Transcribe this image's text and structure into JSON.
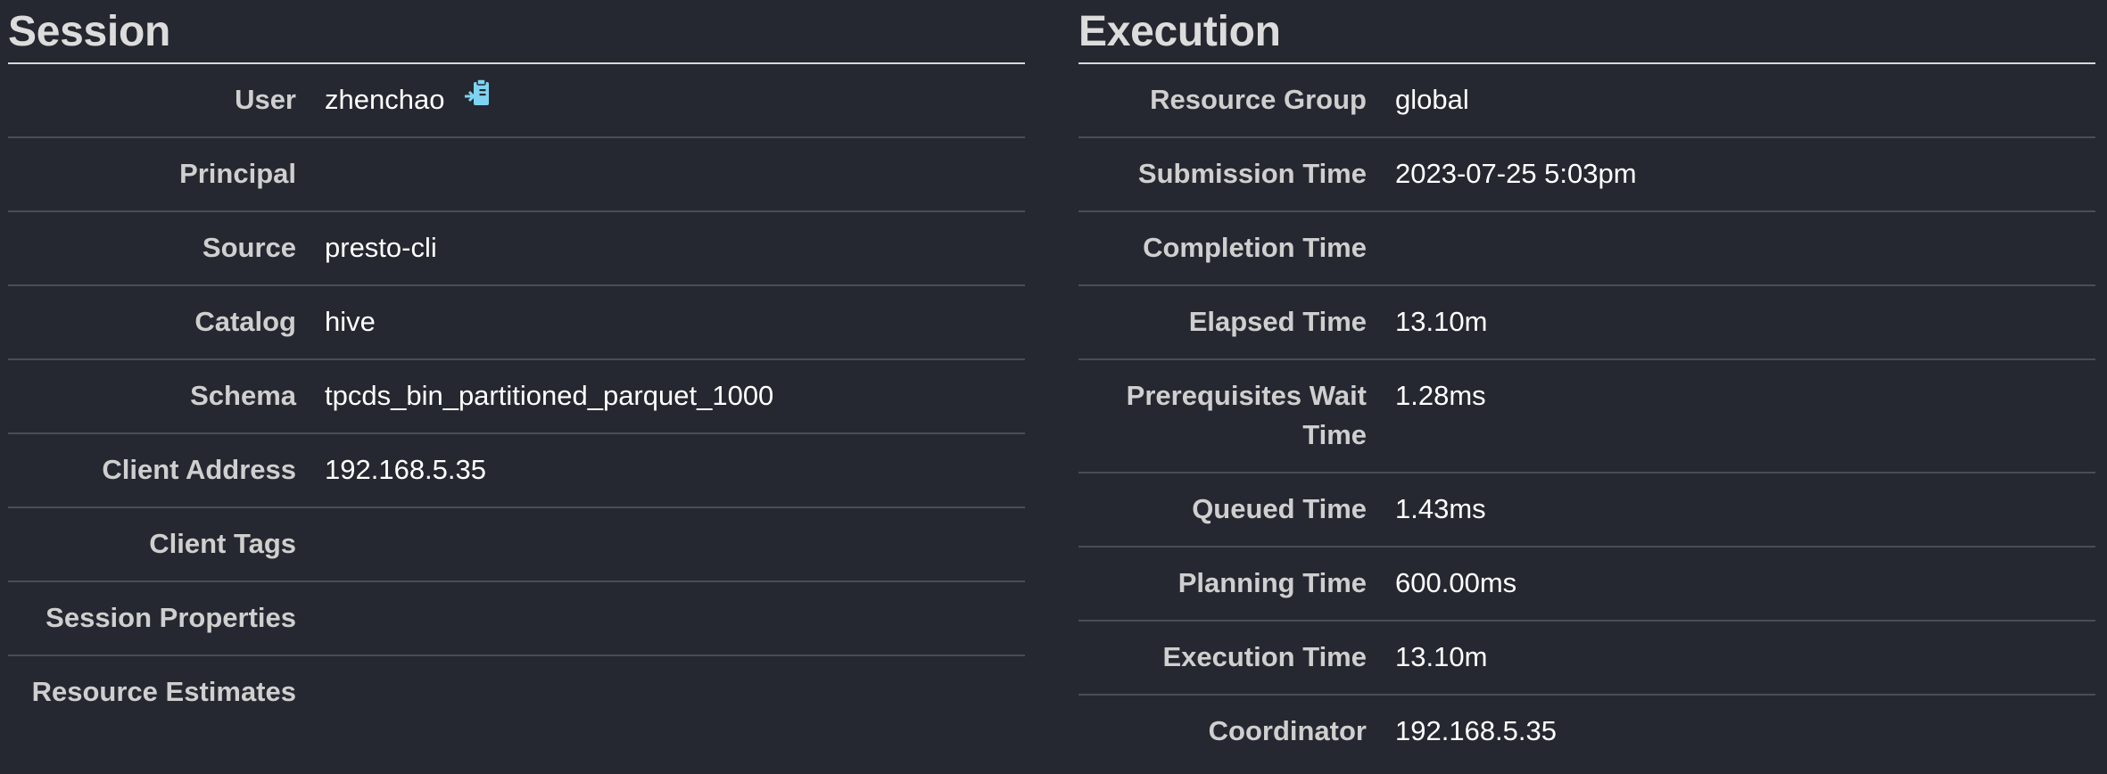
{
  "session": {
    "title": "Session",
    "rows": [
      {
        "label": "User",
        "value": "zhenchao"
      },
      {
        "label": "Principal",
        "value": ""
      },
      {
        "label": "Source",
        "value": "presto-cli"
      },
      {
        "label": "Catalog",
        "value": "hive"
      },
      {
        "label": "Schema",
        "value": "tpcds_bin_partitioned_parquet_1000"
      },
      {
        "label": "Client Address",
        "value": "192.168.5.35"
      },
      {
        "label": "Client Tags",
        "value": ""
      },
      {
        "label": "Session Properties",
        "value": ""
      },
      {
        "label": "Resource Estimates",
        "value": ""
      }
    ],
    "copy_icon": "clipboard-copy-icon"
  },
  "execution": {
    "title": "Execution",
    "rows": [
      {
        "label": "Resource Group",
        "value": "global"
      },
      {
        "label": "Submission Time",
        "value": "2023-07-25 5:03pm"
      },
      {
        "label": "Completion Time",
        "value": ""
      },
      {
        "label": "Elapsed Time",
        "value": "13.10m"
      },
      {
        "label": "Prerequisites Wait Time",
        "value": "1.28ms"
      },
      {
        "label": "Queued Time",
        "value": "1.43ms"
      },
      {
        "label": "Planning Time",
        "value": "600.00ms"
      },
      {
        "label": "Execution Time",
        "value": "13.10m"
      },
      {
        "label": "Coordinator",
        "value": "192.168.5.35"
      }
    ]
  },
  "colors": {
    "background": "#252830",
    "divider": "#4a4d55",
    "header_rule": "#d9d9d9",
    "icon": "#7ed3f0"
  }
}
